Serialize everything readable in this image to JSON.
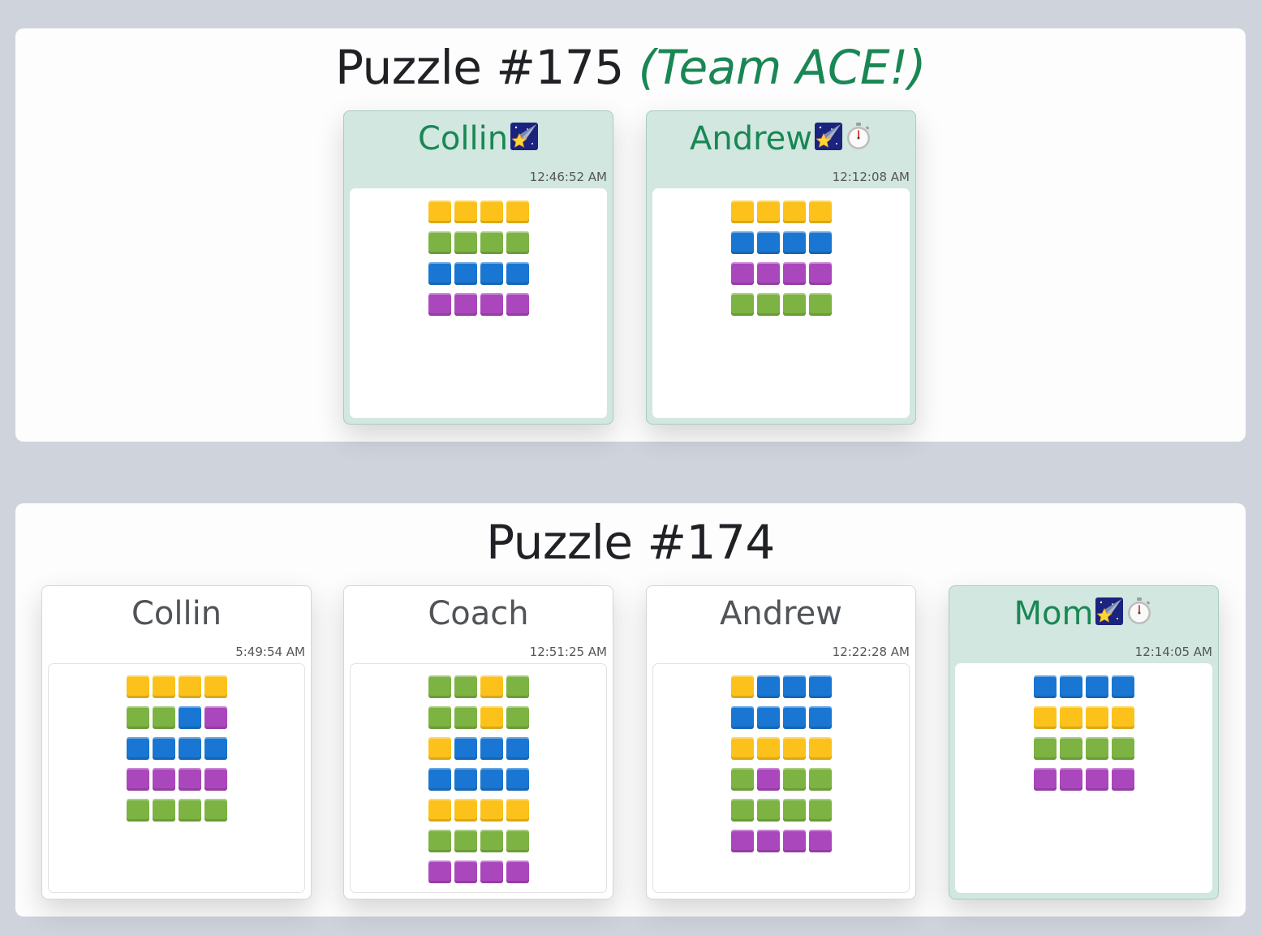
{
  "tile_colors": {
    "yellow": "#fcc21b",
    "green": "#7cb342",
    "blue": "#1976d2",
    "purple": "#ab47bc"
  },
  "accent_color": "#198754",
  "puzzles": [
    {
      "title": "Puzzle #175",
      "team_tag": "(Team ACE!)",
      "cards": [
        {
          "name": "Collin",
          "starred": true,
          "badges": [
            "shooting-star-icon"
          ],
          "time": "12:46:52 AM",
          "rows": [
            [
              "yellow",
              "yellow",
              "yellow",
              "yellow"
            ],
            [
              "green",
              "green",
              "green",
              "green"
            ],
            [
              "blue",
              "blue",
              "blue",
              "blue"
            ],
            [
              "purple",
              "purple",
              "purple",
              "purple"
            ]
          ]
        },
        {
          "name": "Andrew",
          "starred": true,
          "badges": [
            "shooting-star-icon",
            "stopwatch-icon"
          ],
          "time": "12:12:08 AM",
          "rows": [
            [
              "yellow",
              "yellow",
              "yellow",
              "yellow"
            ],
            [
              "blue",
              "blue",
              "blue",
              "blue"
            ],
            [
              "purple",
              "purple",
              "purple",
              "purple"
            ],
            [
              "green",
              "green",
              "green",
              "green"
            ]
          ]
        }
      ]
    },
    {
      "title": "Puzzle #174",
      "team_tag": "",
      "cards": [
        {
          "name": "Collin",
          "starred": false,
          "badges": [],
          "time": "5:49:54 AM",
          "rows": [
            [
              "yellow",
              "yellow",
              "yellow",
              "yellow"
            ],
            [
              "green",
              "green",
              "blue",
              "purple"
            ],
            [
              "blue",
              "blue",
              "blue",
              "blue"
            ],
            [
              "purple",
              "purple",
              "purple",
              "purple"
            ],
            [
              "green",
              "green",
              "green",
              "green"
            ]
          ]
        },
        {
          "name": "Coach",
          "starred": false,
          "badges": [],
          "time": "12:51:25 AM",
          "rows": [
            [
              "green",
              "green",
              "yellow",
              "green"
            ],
            [
              "green",
              "green",
              "yellow",
              "green"
            ],
            [
              "yellow",
              "blue",
              "blue",
              "blue"
            ],
            [
              "blue",
              "blue",
              "blue",
              "blue"
            ],
            [
              "yellow",
              "yellow",
              "yellow",
              "yellow"
            ],
            [
              "green",
              "green",
              "green",
              "green"
            ],
            [
              "purple",
              "purple",
              "purple",
              "purple"
            ]
          ]
        },
        {
          "name": "Andrew",
          "starred": false,
          "badges": [],
          "time": "12:22:28 AM",
          "rows": [
            [
              "yellow",
              "blue",
              "blue",
              "blue"
            ],
            [
              "blue",
              "blue",
              "blue",
              "blue"
            ],
            [
              "yellow",
              "yellow",
              "yellow",
              "yellow"
            ],
            [
              "green",
              "purple",
              "green",
              "green"
            ],
            [
              "green",
              "green",
              "green",
              "green"
            ],
            [
              "purple",
              "purple",
              "purple",
              "purple"
            ]
          ]
        },
        {
          "name": "Mom",
          "starred": true,
          "badges": [
            "shooting-star-icon",
            "stopwatch-icon"
          ],
          "time": "12:14:05 AM",
          "rows": [
            [
              "blue",
              "blue",
              "blue",
              "blue"
            ],
            [
              "yellow",
              "yellow",
              "yellow",
              "yellow"
            ],
            [
              "green",
              "green",
              "green",
              "green"
            ],
            [
              "purple",
              "purple",
              "purple",
              "purple"
            ]
          ]
        }
      ]
    }
  ]
}
